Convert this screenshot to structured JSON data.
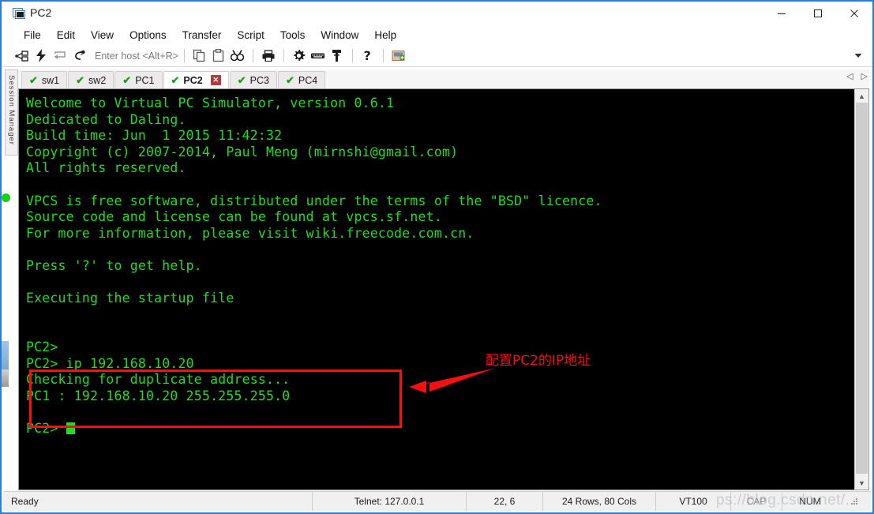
{
  "window": {
    "title": "PC2",
    "icon": "terminal-window-icon",
    "minimize_label": "—",
    "maximize_label": "□",
    "close_label": "✕"
  },
  "menubar": {
    "items": [
      "File",
      "Edit",
      "View",
      "Options",
      "Transfer",
      "Script",
      "Tools",
      "Window",
      "Help"
    ]
  },
  "toolbar": {
    "host_placeholder": "Enter host <Alt+R>",
    "icons": [
      "connect-icon",
      "quick-connect-icon",
      "reconnect-icon",
      "disconnect-icon",
      "copy-icon",
      "paste-icon",
      "find-icon",
      "print-icon",
      "settings-gear-icon",
      "keyboard-icon",
      "key-icon",
      "help-question-icon",
      "session-options-icon"
    ],
    "overflow_label": "▾"
  },
  "session_manager": {
    "label": "Session Manager"
  },
  "tabs": {
    "items": [
      {
        "label": "sw1",
        "active": false,
        "status": "connected"
      },
      {
        "label": "sw2",
        "active": false,
        "status": "connected"
      },
      {
        "label": "PC1",
        "active": false,
        "status": "connected"
      },
      {
        "label": "PC2",
        "active": true,
        "status": "connected"
      },
      {
        "label": "PC3",
        "active": false,
        "status": "connected"
      },
      {
        "label": "PC4",
        "active": false,
        "status": "connected"
      }
    ],
    "check_glyph": "✔",
    "close_glyph": "✕",
    "prev_glyph": "◁",
    "next_glyph": "▷"
  },
  "terminal": {
    "foreground": "#22dd22",
    "background": "#000000",
    "lines": [
      "Welcome to Virtual PC Simulator, version 0.6.1",
      "Dedicated to Daling.",
      "Build time: Jun  1 2015 11:42:32",
      "Copyright (c) 2007-2014, Paul Meng (mirnshi@gmail.com)",
      "All rights reserved.",
      "",
      "VPCS is free software, distributed under the terms of the \"BSD\" licence.",
      "Source code and license can be found at vpcs.sf.net.",
      "For more information, please visit wiki.freecode.com.cn.",
      "",
      "Press '?' to get help.",
      "",
      "Executing the startup file",
      "",
      "",
      "PC2>",
      "PC2> ip 192.168.10.20",
      "Checking for duplicate address...",
      "PC1 : 192.168.10.20 255.255.255.0",
      "",
      "PC2> "
    ]
  },
  "annotation": {
    "text": "配置PC2的IP地址",
    "color": "#f80f0f"
  },
  "statusbar": {
    "ready": "Ready",
    "telnet": "Telnet: 127.0.0.1",
    "position": "22,  6",
    "dimensions": "24 Rows, 80 Cols",
    "emulation": "VT100",
    "cap": "CAP",
    "num": "NUM"
  },
  "watermark": {
    "text": "ps://blog.csdn.net/..."
  },
  "scrollbar": {
    "up_glyph": "▲",
    "down_glyph": "▼"
  }
}
